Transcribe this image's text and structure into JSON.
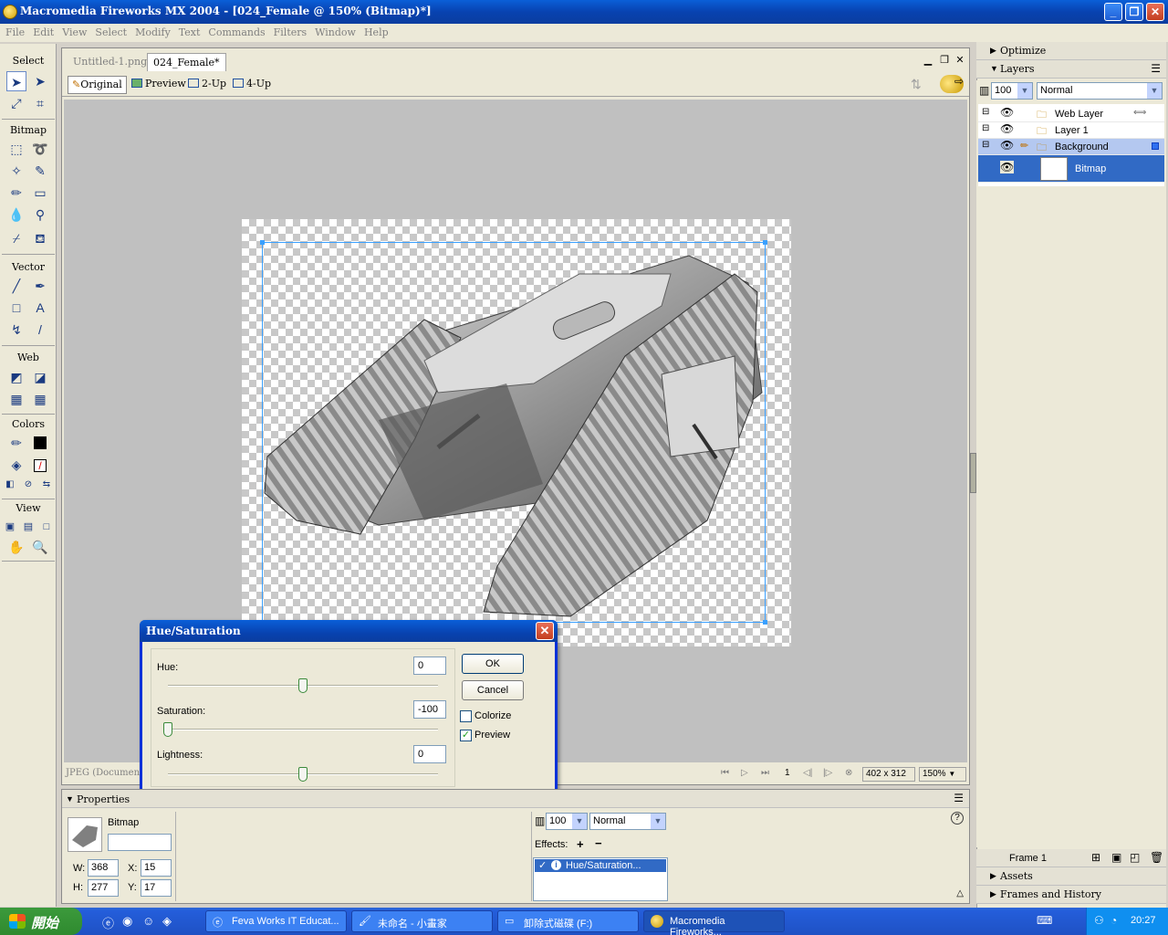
{
  "window": {
    "title": "Macromedia Fireworks MX 2004 - [024_Female @ 150% (Bitmap)*]",
    "minimize": "_",
    "restore": "❐",
    "close": "✕"
  },
  "menu": [
    "File",
    "Edit",
    "View",
    "Select",
    "Modify",
    "Text",
    "Commands",
    "Filters",
    "Window",
    "Help"
  ],
  "toolbox": {
    "sections": [
      "Select",
      "Bitmap",
      "Vector",
      "Web",
      "Colors",
      "View"
    ]
  },
  "document": {
    "tabs": [
      "Untitled-1.png*",
      "024_Female*"
    ],
    "views": [
      "Original",
      "Preview",
      "2-Up",
      "4-Up"
    ],
    "status": {
      "doc_type": "JPEG (Document)",
      "frame": "1",
      "size": "402 x 312",
      "zoom": "150%"
    }
  },
  "dialog": {
    "title": "Hue/Saturation",
    "hue_label": "Hue:",
    "hue_value": "0",
    "hue": 0.5,
    "saturation_label": "Saturation:",
    "saturation_value": "-100",
    "saturation": 0,
    "lightness_label": "Lightness:",
    "lightness_value": "0",
    "lightness": 0.5,
    "ok": "OK",
    "cancel": "Cancel",
    "colorize": "Colorize",
    "colorize_checked": false,
    "preview": "Preview",
    "preview_checked": true
  },
  "properties": {
    "title": "Properties",
    "object_type": "Bitmap",
    "name_value": "",
    "w_label": "W:",
    "w": "368",
    "h_label": "H:",
    "h": "277",
    "x_label": "X:",
    "x": "15",
    "y_label": "Y:",
    "y": "17",
    "opacity": "100",
    "blend": "Normal",
    "effects_label": "Effects:",
    "effects": [
      "Hue/Saturation..."
    ]
  },
  "panels": {
    "optimize": "Optimize",
    "layers": "Layers",
    "layers_opacity": "100",
    "layers_blend": "Normal",
    "layer_rows": [
      "Web Layer",
      "Layer 1",
      "Background",
      "Bitmap"
    ],
    "frame": "Frame 1",
    "assets": "Assets",
    "frames_history": "Frames and History"
  },
  "taskbar": {
    "start": "開始",
    "tasks": [
      "Feva Works IT Educat...",
      "未命名 - 小畫家",
      "卸除式磁碟 (F:)",
      "Macromedia Fireworks..."
    ],
    "clock": "20:27"
  },
  "colors": {
    "titlebar": "#0842b0",
    "selection": "#316ac5",
    "selection_box": "#3aa0ff"
  }
}
